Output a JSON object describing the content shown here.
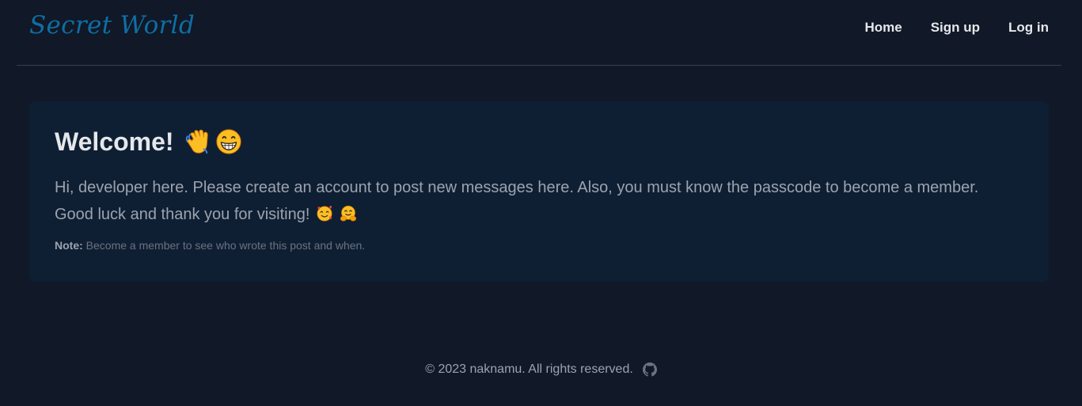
{
  "header": {
    "brand": "Secret World",
    "nav": [
      {
        "label": "Home"
      },
      {
        "label": "Sign up"
      },
      {
        "label": "Log in"
      }
    ]
  },
  "card": {
    "title": "Welcome!",
    "title_emojis": [
      "waving-hand-icon",
      "grinning-face-icon"
    ],
    "body": "Hi, developer here. Please create an account to post new messages here. Also, you must know the passcode to become a member. Good luck and thank you for visiting!",
    "body_emojis": [
      "smiling-face-with-hearts-icon",
      "hugging-face-icon"
    ],
    "note_label": "Note:",
    "note_text": "Become a member to see who wrote this post and when."
  },
  "footer": {
    "copyright": "© 2023 naknamu. All rights reserved.",
    "icon": "github-icon"
  },
  "colors": {
    "background": "#111827",
    "card": "#0f1f33",
    "brand": "#0e6ea3",
    "divider": "#374151"
  }
}
